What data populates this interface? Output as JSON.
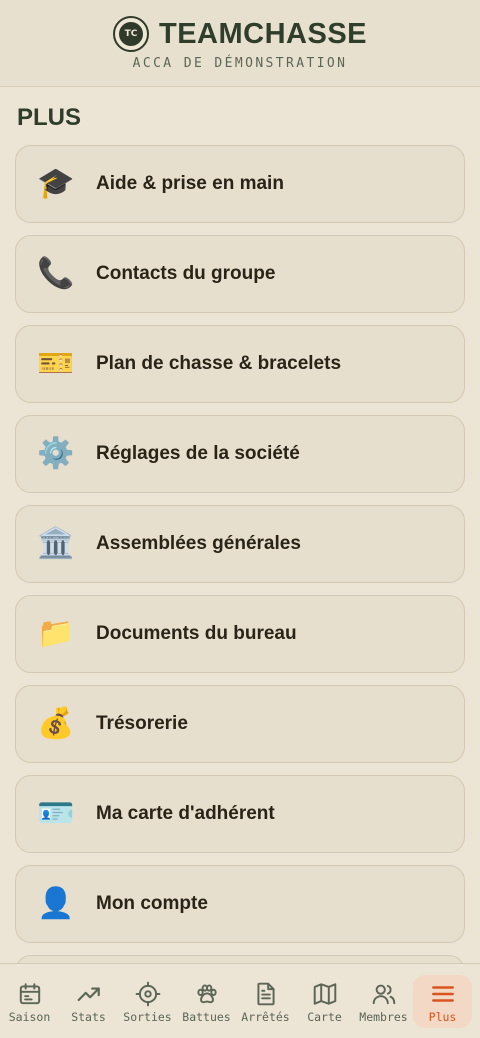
{
  "header": {
    "logo_text": "TC",
    "title": "TEAMCHASSE",
    "subtitle": "ACCA DE DÉMONSTRATION"
  },
  "section_title": "PLUS",
  "menu": [
    {
      "icon": "🎓",
      "icon_name": "graduation-cap-icon",
      "label": "Aide & prise en main"
    },
    {
      "icon": "📞",
      "icon_name": "phone-icon",
      "label": "Contacts du groupe"
    },
    {
      "icon": "🎫",
      "icon_name": "ticket-icon",
      "label": "Plan de chasse & bracelets"
    },
    {
      "icon": "⚙️",
      "icon_name": "gear-icon",
      "label": "Réglages de la société"
    },
    {
      "icon": "🏛️",
      "icon_name": "classical-building-icon",
      "label": "Assemblées générales"
    },
    {
      "icon": "📁",
      "icon_name": "folder-icon",
      "label": "Documents du bureau"
    },
    {
      "icon": "💰",
      "icon_name": "money-bag-icon",
      "label": "Trésorerie"
    },
    {
      "icon": "🪪",
      "icon_name": "id-card-icon",
      "label": "Ma carte d'adhérent"
    },
    {
      "icon": "👤",
      "icon_name": "user-icon",
      "label": "Mon compte"
    }
  ],
  "nav": [
    {
      "label": "Saison",
      "icon_name": "calendar-icon"
    },
    {
      "label": "Stats",
      "icon_name": "trending-up-icon"
    },
    {
      "label": "Sorties",
      "icon_name": "crosshair-icon"
    },
    {
      "label": "Battues",
      "icon_name": "paw-icon"
    },
    {
      "label": "Arrêtés",
      "icon_name": "document-icon"
    },
    {
      "label": "Carte",
      "icon_name": "map-icon"
    },
    {
      "label": "Membres",
      "icon_name": "users-icon"
    },
    {
      "label": "Plus",
      "icon_name": "menu-icon",
      "active": true
    }
  ],
  "colors": {
    "background": "#ece4d4",
    "card": "#e7dfcd",
    "primary_text": "#2f3d2b",
    "nav_text": "#5b6656",
    "active_accent": "#d9541f",
    "active_bg": "#f3d9c5"
  }
}
